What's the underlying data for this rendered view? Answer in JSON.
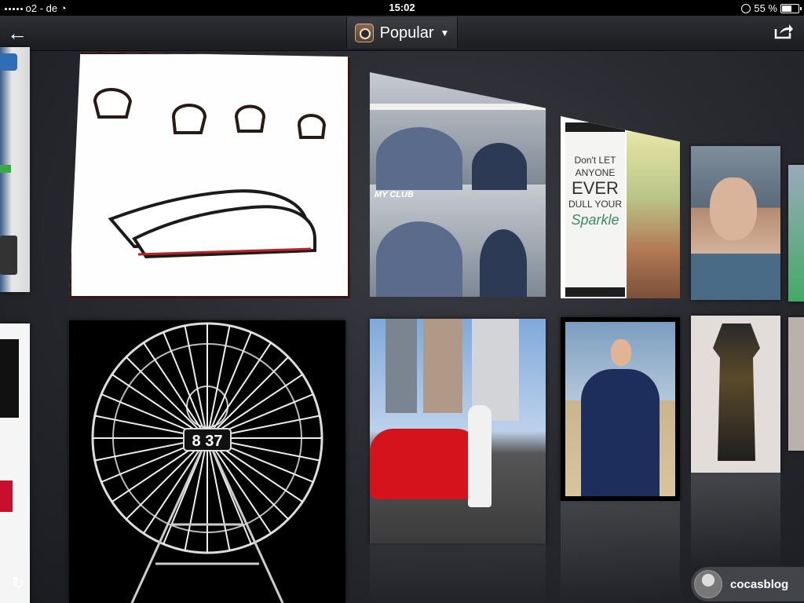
{
  "status_bar": {
    "carrier": "o2 - de",
    "time": "15:02",
    "battery": "55 %",
    "battery_level": 0.55
  },
  "nav": {
    "title": "Popular",
    "back_icon": "arrow-left-icon",
    "share_icon": "share-icon",
    "logo_icon": "instagram-camera-icon"
  },
  "tiles": [
    {
      "id": "left-partial-top",
      "desc_icon": "image"
    },
    {
      "id": "shoes-tile",
      "caption": ""
    },
    {
      "id": "club-tile",
      "text_overlay": "MY CLUB"
    },
    {
      "id": "sparkle-tile",
      "quote_lines": [
        "Don't LET",
        "ANYONE",
        "EVER",
        "DULL YOUR",
        "Sparkle"
      ]
    },
    {
      "id": "selfie-tile"
    },
    {
      "id": "left-partial-bottom"
    },
    {
      "id": "ferris-tile",
      "sign": "8 37"
    },
    {
      "id": "car-tile"
    },
    {
      "id": "man-pose-tile"
    },
    {
      "id": "dress-tile"
    }
  ],
  "user_badge": {
    "username": "cocasblog"
  },
  "colors": {
    "background": "#2a2b31",
    "navbar": "#1b1c1f",
    "accent_red": "#c8102e"
  }
}
